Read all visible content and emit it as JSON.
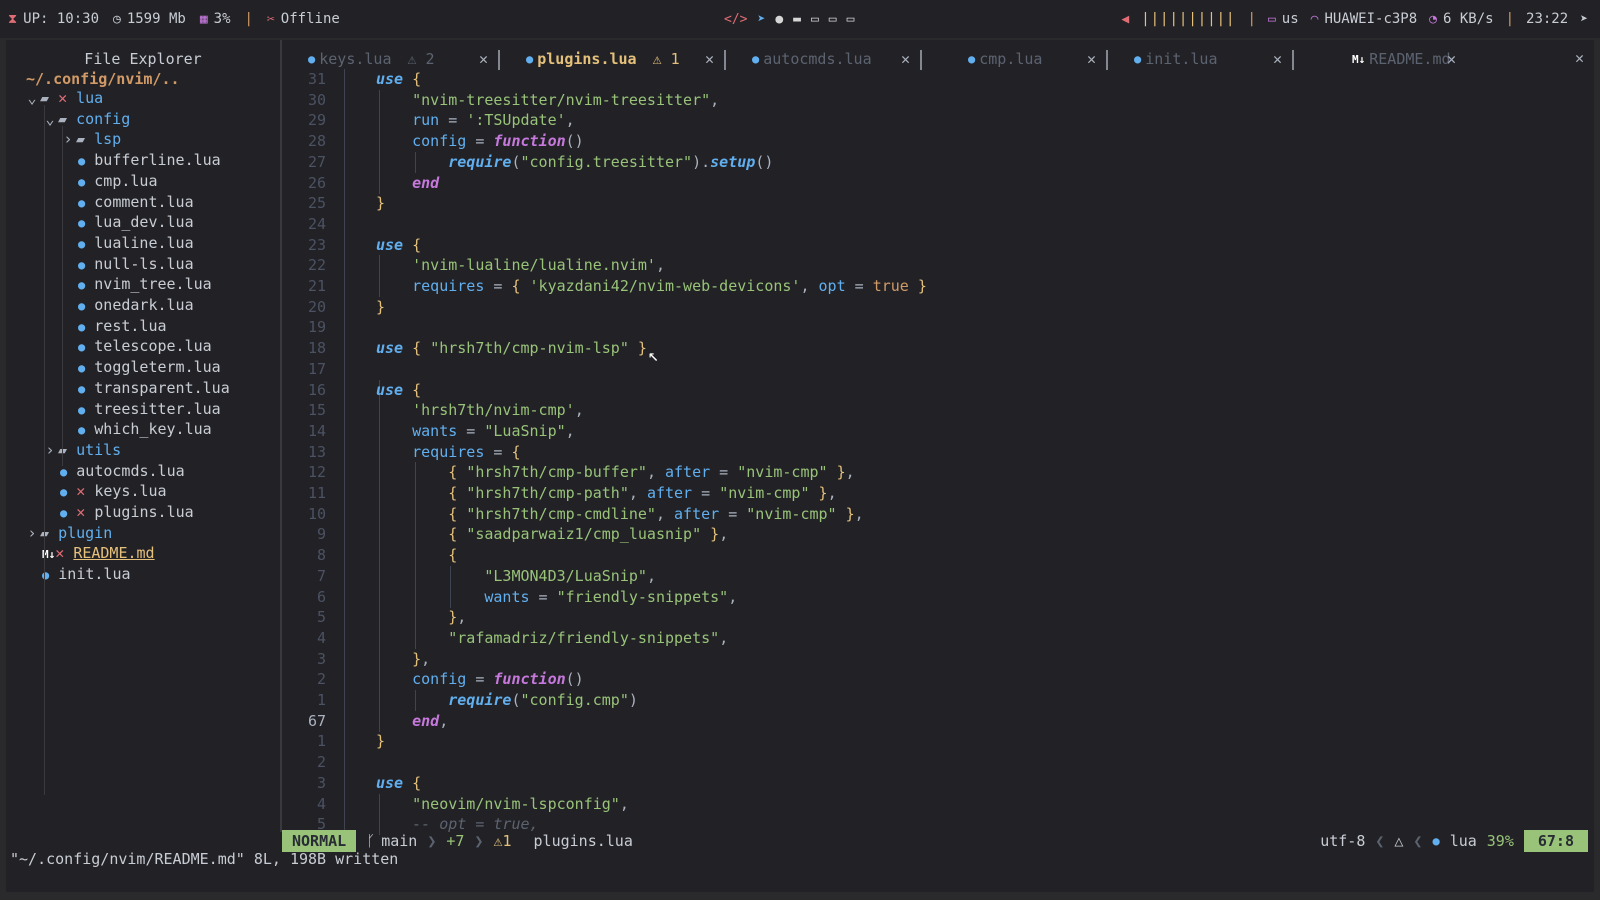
{
  "topbar": {
    "uptime": "UP: 10:30",
    "memory": "1599 Mb",
    "cpu": "3%",
    "network_status": "Offline",
    "volume_bars": "||||||||||",
    "keyboard_layout": "us",
    "wifi_name": "HUAWEI-c3P8",
    "net_speed": "6 KB/s",
    "clock": "23:22"
  },
  "explorer": {
    "title": "File Explorer",
    "root": "~/.config/nvim/..",
    "rows": [
      {
        "label": "lua",
        "depth": 0,
        "kind": "folder-open",
        "x": true
      },
      {
        "label": "config",
        "depth": 1,
        "kind": "folder-open"
      },
      {
        "label": "lsp",
        "depth": 2,
        "kind": "folder"
      },
      {
        "label": "bufferline.lua",
        "depth": 3,
        "kind": "file"
      },
      {
        "label": "cmp.lua",
        "depth": 3,
        "kind": "file"
      },
      {
        "label": "comment.lua",
        "depth": 3,
        "kind": "file"
      },
      {
        "label": "lua_dev.lua",
        "depth": 3,
        "kind": "file"
      },
      {
        "label": "lualine.lua",
        "depth": 3,
        "kind": "file"
      },
      {
        "label": "null-ls.lua",
        "depth": 3,
        "kind": "file"
      },
      {
        "label": "nvim_tree.lua",
        "depth": 3,
        "kind": "file"
      },
      {
        "label": "onedark.lua",
        "depth": 3,
        "kind": "file"
      },
      {
        "label": "rest.lua",
        "depth": 3,
        "kind": "file"
      },
      {
        "label": "telescope.lua",
        "depth": 3,
        "kind": "file"
      },
      {
        "label": "toggleterm.lua",
        "depth": 3,
        "kind": "file"
      },
      {
        "label": "transparent.lua",
        "depth": 3,
        "kind": "file"
      },
      {
        "label": "treesitter.lua",
        "depth": 3,
        "kind": "file"
      },
      {
        "label": "which_key.lua",
        "depth": 3,
        "kind": "file"
      },
      {
        "label": "utils",
        "depth": 1,
        "kind": "folder"
      },
      {
        "label": "autocmds.lua",
        "depth": 2,
        "kind": "file"
      },
      {
        "label": "keys.lua",
        "depth": 2,
        "kind": "file",
        "x": true
      },
      {
        "label": "plugins.lua",
        "depth": 2,
        "kind": "file",
        "x": true
      },
      {
        "label": "plugin",
        "depth": 0,
        "kind": "folder"
      },
      {
        "label": "README.md",
        "depth": 1,
        "kind": "md",
        "x": true
      },
      {
        "label": "init.lua",
        "depth": 1,
        "kind": "file"
      }
    ]
  },
  "tabs": [
    {
      "name": "keys.lua",
      "badge": "⚠ 2",
      "active": false
    },
    {
      "name": "plugins.lua",
      "badge": "⚠ 1",
      "active": true
    },
    {
      "name": "autocmds.lua",
      "badge": "",
      "active": false
    },
    {
      "name": "cmp.lua",
      "badge": "",
      "active": false
    },
    {
      "name": "init.lua",
      "badge": "",
      "active": false
    },
    {
      "name": "README.md",
      "badge": "",
      "active": false
    }
  ],
  "code": {
    "line_numbers": [
      "31",
      "30",
      "29",
      "28",
      "27",
      "26",
      "25",
      "24",
      "23",
      "22",
      "21",
      "20",
      "19",
      "18",
      "17",
      "16",
      "15",
      "14",
      "13",
      "12",
      "11",
      "10",
      "9",
      "8",
      "7",
      "6",
      "5",
      "4",
      "3",
      "2",
      "1",
      "67",
      "1",
      "2",
      "3",
      "4",
      "5"
    ],
    "current_line": "67",
    "lines": [
      [
        [
          "kw",
          "use"
        ],
        [
          "pl",
          " "
        ],
        [
          "br",
          "{"
        ]
      ],
      [
        [
          "pl",
          "    "
        ],
        [
          "str",
          "\"nvim-treesitter/nvim-treesitter\""
        ],
        [
          "pl",
          ","
        ]
      ],
      [
        [
          "pl",
          "    "
        ],
        [
          "key",
          "run"
        ],
        [
          "pl",
          " = "
        ],
        [
          "str",
          "':TSUpdate'"
        ],
        [
          "pl",
          ","
        ]
      ],
      [
        [
          "pl",
          "    "
        ],
        [
          "key",
          "config"
        ],
        [
          "pl",
          " = "
        ],
        [
          "fn",
          "function"
        ],
        [
          "pl",
          "()"
        ]
      ],
      [
        [
          "pl",
          "        "
        ],
        [
          "call",
          "require"
        ],
        [
          "pl",
          "("
        ],
        [
          "str",
          "\"config.treesitter\""
        ],
        [
          "pl",
          ")."
        ],
        [
          "call",
          "setup"
        ],
        [
          "pl",
          "()"
        ]
      ],
      [
        [
          "pl",
          "    "
        ],
        [
          "fn",
          "end"
        ]
      ],
      [
        [
          "br",
          "}"
        ]
      ],
      [
        [
          "pl",
          ""
        ]
      ],
      [
        [
          "kw",
          "use"
        ],
        [
          "pl",
          " "
        ],
        [
          "br",
          "{"
        ]
      ],
      [
        [
          "pl",
          "    "
        ],
        [
          "str",
          "'nvim-lualine/lualine.nvim'"
        ],
        [
          "pl",
          ","
        ]
      ],
      [
        [
          "pl",
          "    "
        ],
        [
          "key",
          "requires"
        ],
        [
          "pl",
          " = "
        ],
        [
          "br",
          "{"
        ],
        [
          "pl",
          " "
        ],
        [
          "str",
          "'kyazdani42/nvim-web-devicons'"
        ],
        [
          "pl",
          ", "
        ],
        [
          "key",
          "opt"
        ],
        [
          "pl",
          " = "
        ],
        [
          "bool",
          "true"
        ],
        [
          "pl",
          " "
        ],
        [
          "br",
          "}"
        ]
      ],
      [
        [
          "br",
          "}"
        ]
      ],
      [
        [
          "pl",
          ""
        ]
      ],
      [
        [
          "kw",
          "use"
        ],
        [
          "pl",
          " "
        ],
        [
          "br",
          "{"
        ],
        [
          "pl",
          " "
        ],
        [
          "str",
          "\"hrsh7th/cmp-nvim-lsp\""
        ],
        [
          "pl",
          " "
        ],
        [
          "br",
          "}"
        ]
      ],
      [
        [
          "pl",
          ""
        ]
      ],
      [
        [
          "kw",
          "use"
        ],
        [
          "pl",
          " "
        ],
        [
          "br",
          "{"
        ]
      ],
      [
        [
          "pl",
          "    "
        ],
        [
          "str",
          "'hrsh7th/nvim-cmp'"
        ],
        [
          "pl",
          ","
        ]
      ],
      [
        [
          "pl",
          "    "
        ],
        [
          "key",
          "wants"
        ],
        [
          "pl",
          " = "
        ],
        [
          "str",
          "\"LuaSnip\""
        ],
        [
          "pl",
          ","
        ]
      ],
      [
        [
          "pl",
          "    "
        ],
        [
          "key",
          "requires"
        ],
        [
          "pl",
          " = "
        ],
        [
          "br",
          "{"
        ]
      ],
      [
        [
          "pl",
          "        "
        ],
        [
          "br",
          "{"
        ],
        [
          "pl",
          " "
        ],
        [
          "str",
          "\"hrsh7th/cmp-buffer\""
        ],
        [
          "pl",
          ", "
        ],
        [
          "key",
          "after"
        ],
        [
          "pl",
          " = "
        ],
        [
          "str",
          "\"nvim-cmp\""
        ],
        [
          "pl",
          " "
        ],
        [
          "br",
          "}"
        ],
        [
          "pl",
          ","
        ]
      ],
      [
        [
          "pl",
          "        "
        ],
        [
          "br",
          "{"
        ],
        [
          "pl",
          " "
        ],
        [
          "str",
          "\"hrsh7th/cmp-path\""
        ],
        [
          "pl",
          ", "
        ],
        [
          "key",
          "after"
        ],
        [
          "pl",
          " = "
        ],
        [
          "str",
          "\"nvim-cmp\""
        ],
        [
          "pl",
          " "
        ],
        [
          "br",
          "}"
        ],
        [
          "pl",
          ","
        ]
      ],
      [
        [
          "pl",
          "        "
        ],
        [
          "br",
          "{"
        ],
        [
          "pl",
          " "
        ],
        [
          "str",
          "\"hrsh7th/cmp-cmdline\""
        ],
        [
          "pl",
          ", "
        ],
        [
          "key",
          "after"
        ],
        [
          "pl",
          " = "
        ],
        [
          "str",
          "\"nvim-cmp\""
        ],
        [
          "pl",
          " "
        ],
        [
          "br",
          "}"
        ],
        [
          "pl",
          ","
        ]
      ],
      [
        [
          "pl",
          "        "
        ],
        [
          "br",
          "{"
        ],
        [
          "pl",
          " "
        ],
        [
          "str",
          "\"saadparwaiz1/cmp_luasnip\""
        ],
        [
          "pl",
          " "
        ],
        [
          "br",
          "}"
        ],
        [
          "pl",
          ","
        ]
      ],
      [
        [
          "pl",
          "        "
        ],
        [
          "br",
          "{"
        ]
      ],
      [
        [
          "pl",
          "            "
        ],
        [
          "str",
          "\"L3MON4D3/LuaSnip\""
        ],
        [
          "pl",
          ","
        ]
      ],
      [
        [
          "pl",
          "            "
        ],
        [
          "key",
          "wants"
        ],
        [
          "pl",
          " = "
        ],
        [
          "str",
          "\"friendly-snippets\""
        ],
        [
          "pl",
          ","
        ]
      ],
      [
        [
          "pl",
          "        "
        ],
        [
          "br",
          "}"
        ],
        [
          "pl",
          ","
        ]
      ],
      [
        [
          "pl",
          "        "
        ],
        [
          "str",
          "\"rafamadriz/friendly-snippets\""
        ],
        [
          "pl",
          ","
        ]
      ],
      [
        [
          "pl",
          "    "
        ],
        [
          "br",
          "}"
        ],
        [
          "pl",
          ","
        ]
      ],
      [
        [
          "pl",
          "    "
        ],
        [
          "key",
          "config"
        ],
        [
          "pl",
          " = "
        ],
        [
          "fn",
          "function"
        ],
        [
          "pl",
          "()"
        ]
      ],
      [
        [
          "pl",
          "        "
        ],
        [
          "call",
          "require"
        ],
        [
          "pl",
          "("
        ],
        [
          "str",
          "\"config.cmp\""
        ],
        [
          "pl",
          ")"
        ]
      ],
      [
        [
          "pl",
          "    "
        ],
        [
          "fn",
          "end"
        ],
        [
          "pl",
          ","
        ]
      ],
      [
        [
          "br",
          "}"
        ]
      ],
      [
        [
          "pl",
          ""
        ]
      ],
      [
        [
          "kw",
          "use"
        ],
        [
          "pl",
          " "
        ],
        [
          "br",
          "{"
        ]
      ],
      [
        [
          "pl",
          "    "
        ],
        [
          "str",
          "\"neovim/nvim-lspconfig\""
        ],
        [
          "pl",
          ","
        ]
      ],
      [
        [
          "pl",
          "    "
        ],
        [
          "cm",
          "-- opt = true,"
        ]
      ]
    ]
  },
  "statusline": {
    "mode": "NORMAL",
    "branch": "main",
    "changes": "+7",
    "warnings": "⚠1",
    "filename": "plugins.lua",
    "encoding": "utf-8",
    "filetype": "lua",
    "percent": "39%",
    "position": "67:8"
  },
  "message": "\"~/.config/nvim/README.md\" 8L, 198B written"
}
